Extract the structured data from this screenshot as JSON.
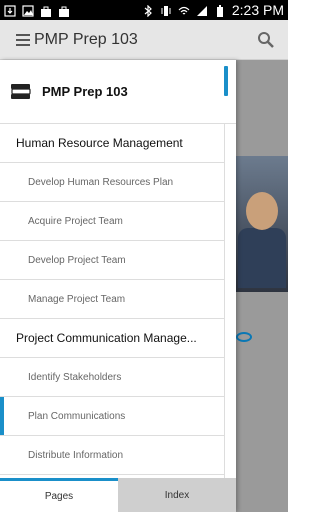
{
  "status_bar": {
    "time": "2:23 PM"
  },
  "app": {
    "title": "PMP Prep 103"
  },
  "drawer": {
    "title": "PMP Prep 103",
    "items": [
      {
        "label": "Human Resource Management",
        "type": "section"
      },
      {
        "label": "Develop Human Resources Plan",
        "type": "sub"
      },
      {
        "label": "Acquire Project Team",
        "type": "sub"
      },
      {
        "label": "Develop Project Team",
        "type": "sub"
      },
      {
        "label": "Manage Project Team",
        "type": "sub"
      },
      {
        "label": "Project Communication Manage...",
        "type": "section"
      },
      {
        "label": "Identify Stakeholders",
        "type": "sub"
      },
      {
        "label": "Plan Communications",
        "type": "sub",
        "selected": true
      },
      {
        "label": "Distribute Information",
        "type": "sub"
      }
    ],
    "tabs": [
      {
        "label": "Pages",
        "active": true
      },
      {
        "label": "Index",
        "active": false
      }
    ]
  },
  "colors": {
    "accent": "#1a8fc9"
  }
}
